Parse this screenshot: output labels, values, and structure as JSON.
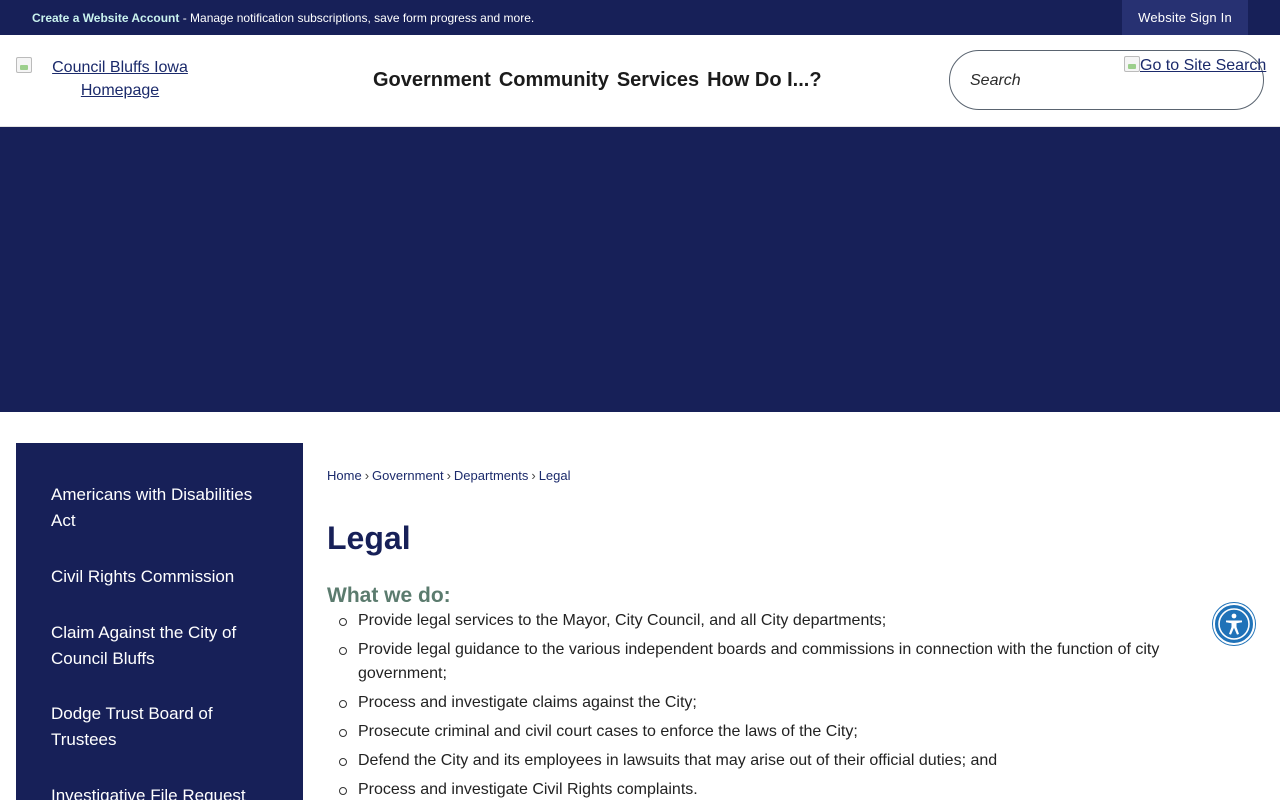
{
  "topbar": {
    "create_account": "Create a Website Account",
    "message": " - Manage notification subscriptions, save form progress and more.",
    "sign_in": "Website Sign In"
  },
  "header": {
    "logo_alt": "Council Bluffs Iowa Homepage",
    "nav": [
      "Government",
      "Community",
      "Services",
      "How Do I...?"
    ],
    "search_placeholder": "Search",
    "search_button_alt": "Go to Site Search"
  },
  "sidebar": {
    "items": [
      "Americans with Disabilities Act",
      "Civil Rights Commission",
      "Claim Against the City of Council Bluffs",
      "Dodge Trust Board of Trustees",
      "Investigative File Request"
    ]
  },
  "breadcrumb": [
    "Home",
    "Government",
    "Departments",
    "Legal"
  ],
  "main": {
    "title": "Legal",
    "subheading": "What we do:",
    "bullets": [
      "Provide legal services to the Mayor, City Council, and all City departments;",
      "Provide legal guidance to the various independent boards and commissions in connection with the function of city government;",
      "Process and investigate claims against the City;",
      "Prosecute criminal and civil court cases to enforce the laws of the City;",
      "Defend the City and its employees in lawsuits that may arise out of their official duties; and",
      "Process and investigate Civil Rights complaints."
    ]
  },
  "icons": {
    "accessibility": "accessibility-icon",
    "broken_image": "broken-image-icon"
  },
  "colors": {
    "navy": "#172058",
    "subhead_green": "#5b7b6e",
    "a11y_blue": "#1f72b8"
  }
}
